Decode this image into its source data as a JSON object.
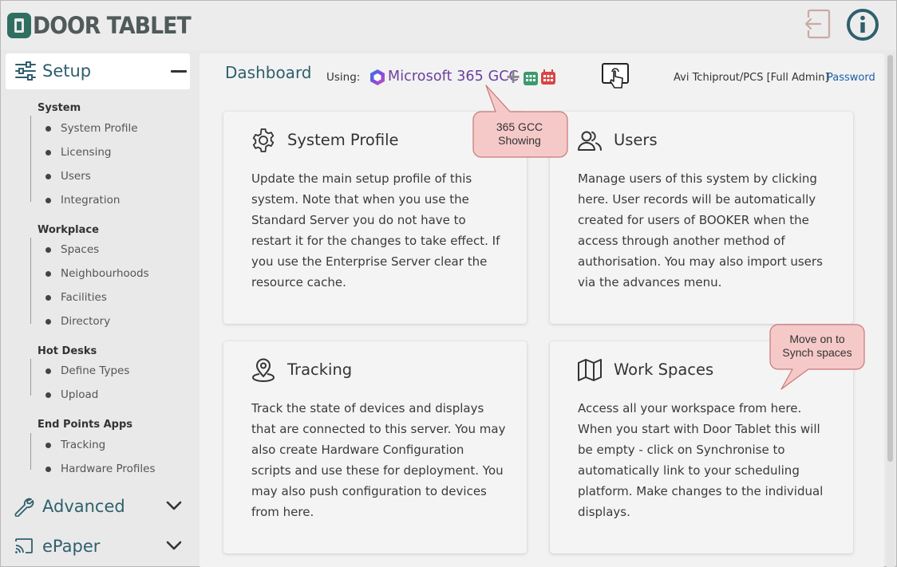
{
  "app": {
    "brand": "DOOR TABLET"
  },
  "header": {
    "logout_icon": "logout-icon",
    "info_icon": "info-icon"
  },
  "sidebar": {
    "setup_label": "Setup",
    "groups": [
      {
        "title": "System",
        "items": [
          "System Profile",
          "Licensing",
          "Users",
          "Integration"
        ]
      },
      {
        "title": "Workplace",
        "items": [
          "Spaces",
          "Neighbourhoods",
          "Facilities",
          "Directory"
        ]
      },
      {
        "title": "Hot Desks",
        "items": [
          "Define Types",
          "Upload"
        ]
      },
      {
        "title": "End Points Apps",
        "items": [
          "Tracking",
          "Hardware Profiles"
        ]
      }
    ],
    "advanced_label": "Advanced",
    "epaper_label": "ePaper"
  },
  "main": {
    "title": "Dashboard",
    "using_label": "Using:",
    "provider": "Microsoft 365 GCC",
    "plus": "+",
    "user": "Avi Tchiprout/PCS [Full Admin]",
    "password_link": "Password"
  },
  "cards": [
    {
      "title": "System Profile",
      "icon": "gear-icon",
      "body": "Update the main setup profile of this system. Note that when you use the Standard Server you do not have to restart it for the changes to take effect. If you use the Enterprise Server clear the resource cache."
    },
    {
      "title": "Users",
      "icon": "users-icon",
      "body": "Manage users of this system by clicking here. User records will be automatically created for users of BOOKER when the access through another method of authorisation. You may also import users via the advances menu."
    },
    {
      "title": "Tracking",
      "icon": "location-pin-icon",
      "body": "Track the state of devices and displays that are connected to this server. You may also create Hardware Configuration scripts and use these for deployment. You may also push configuration to devices from here."
    },
    {
      "title": "Work Spaces",
      "icon": "map-icon",
      "body": "Access all your workspace from here. When you start with Door Tablet this will be empty - click on Synchronise to automatically link to your scheduling platform. Make changes to the individual displays."
    }
  ],
  "callouts": {
    "gcc": [
      "365 GCC",
      "Showing"
    ],
    "synch": [
      "Move on to",
      "Synch spaces"
    ]
  },
  "colors": {
    "accent": "#2f5f6d",
    "brand_green": "#2f6f62",
    "callout_fill": "#f6c9c9",
    "link": "#1a5fa8"
  }
}
